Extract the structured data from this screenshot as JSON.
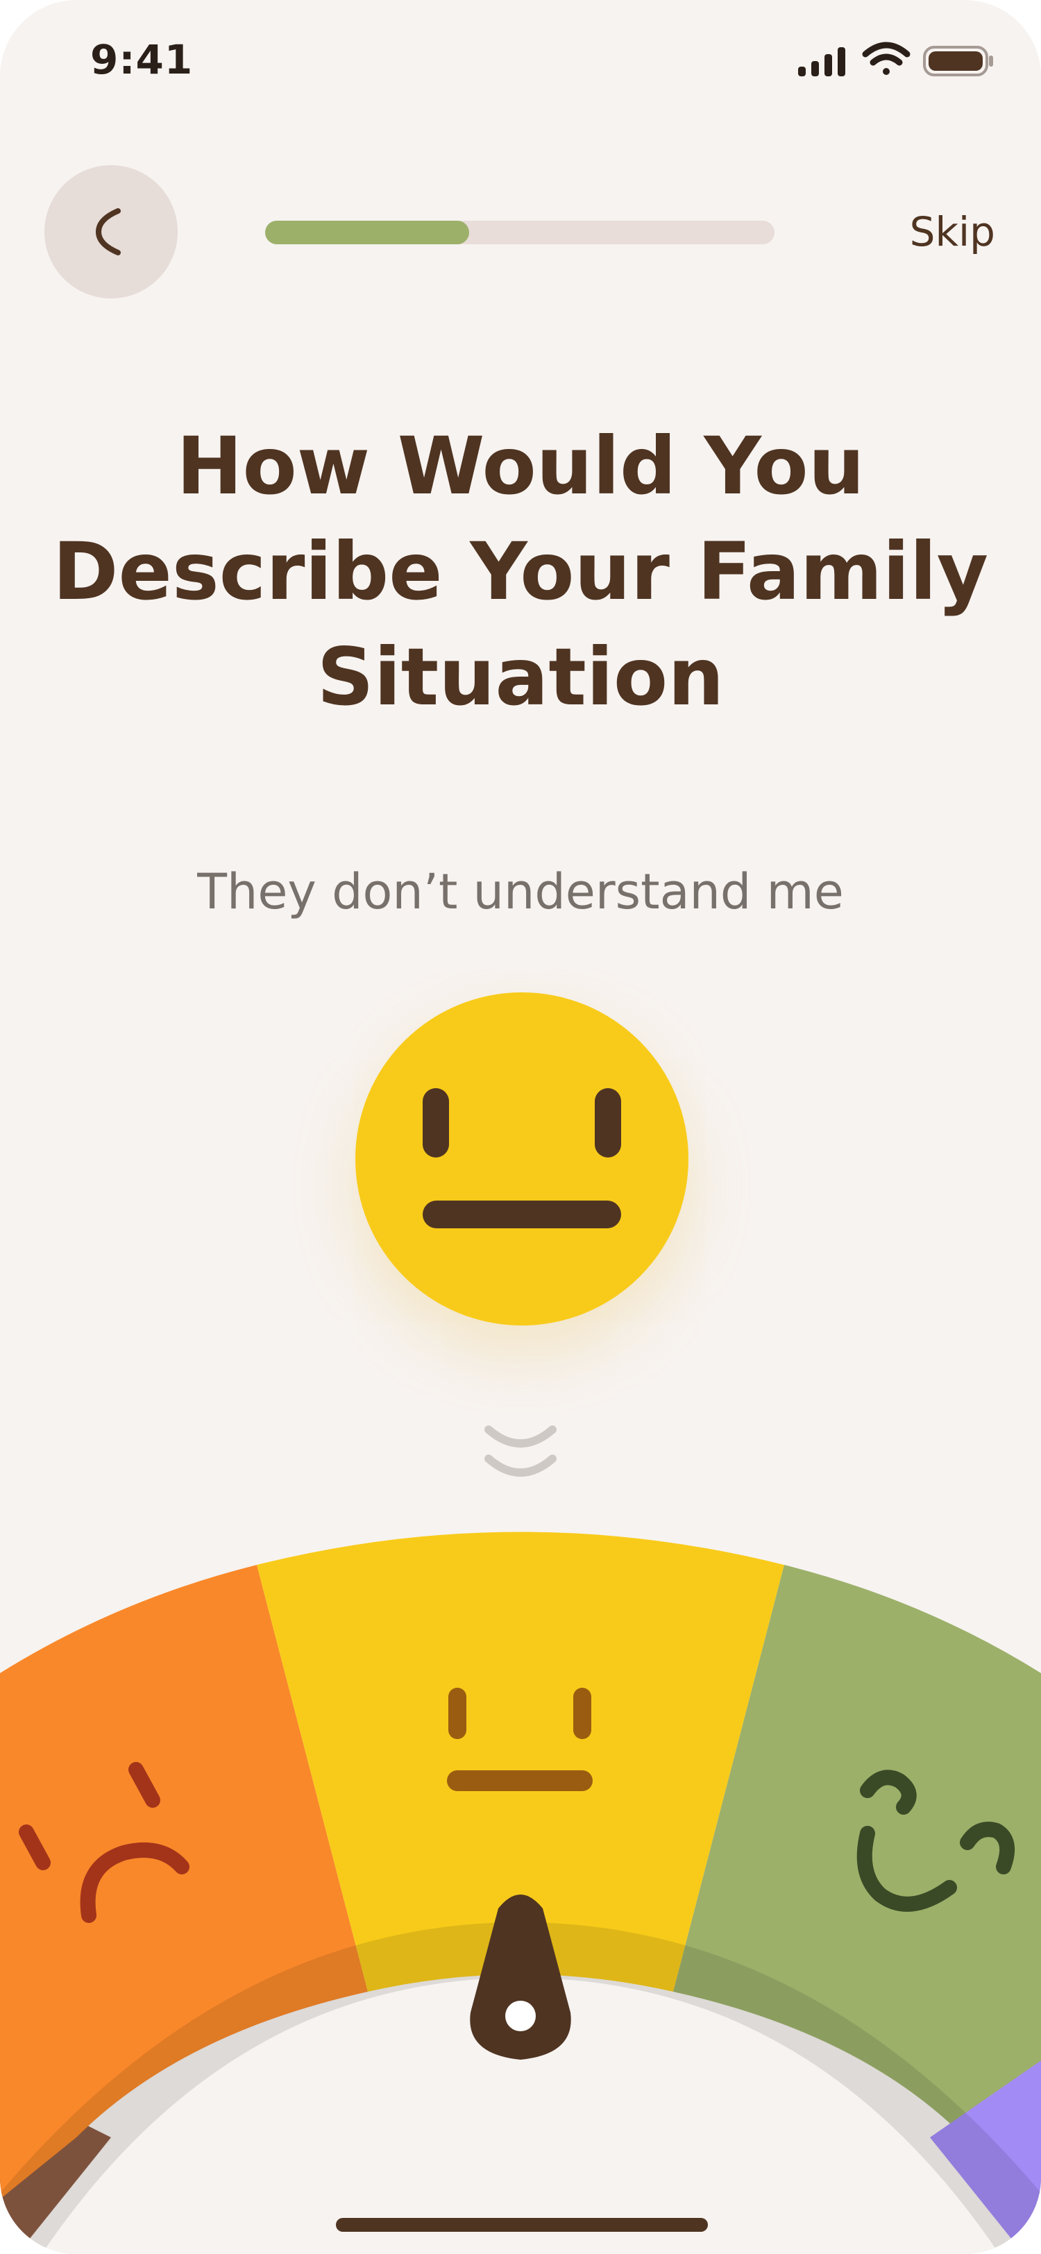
{
  "status_bar": {
    "time": "9:41",
    "icons": [
      "signal-icon",
      "wifi-icon",
      "battery-icon"
    ]
  },
  "header": {
    "back_icon": "back-arrow-icon",
    "progress_fraction": 0.4,
    "skip_label": "Skip"
  },
  "question": {
    "title_lines": [
      "How Would You",
      "Describe Your Family",
      "Situation"
    ]
  },
  "selection": {
    "label": "They don’t understand me",
    "face_icon": "neutral-face-icon"
  },
  "dial": {
    "segments": [
      {
        "name": "very-sad",
        "color": "#6b4433"
      },
      {
        "name": "sad",
        "color": "#f9882a"
      },
      {
        "name": "neutral",
        "color": "#f8cb1a"
      },
      {
        "name": "happy",
        "color": "#9cb06a"
      },
      {
        "name": "very-happy",
        "color": "#a38bf5"
      }
    ],
    "selected": "neutral",
    "pointer_icon": "needle-icon"
  },
  "colors": {
    "background": "#f7f3f0",
    "text_primary": "#4f3422",
    "text_secondary": "#77706b",
    "accent_green": "#9cb06a",
    "accent_yellow": "#f8cb1a",
    "accent_orange": "#f9882a"
  }
}
